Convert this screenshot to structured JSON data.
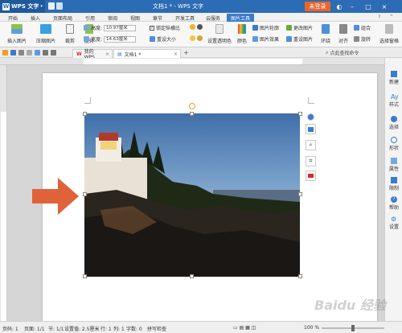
{
  "titlebar": {
    "app_name": "WPS 文字",
    "doc_title": "文档1 * - WPS 文字",
    "login_label": "未登录",
    "minimize": "–",
    "restore": "□",
    "close": "×"
  },
  "menu": {
    "tabs": [
      "开始",
      "插入",
      "页面布局",
      "引用",
      "审阅",
      "视图",
      "章节",
      "开发工具",
      "云服务",
      "图片工具"
    ],
    "active_index": 9
  },
  "ribbon": {
    "insert_picture": "插入图片",
    "compress_picture": "压缩图片",
    "crop": "裁剪",
    "rotate": "旋转",
    "height_label": "高度:",
    "height_value": "10.97厘米",
    "width_label": "宽度:",
    "width_value": "14.63厘米",
    "lock_ratio": "锁定纵横比",
    "reset_size": "重设大小",
    "set_transparent": "设置透明色",
    "color": "颜色",
    "picture_outline": "图片轮廓",
    "picture_effect": "图片效果",
    "change_picture": "更改图片",
    "reset_picture": "重设图片",
    "wrap": "环绕",
    "align": "对齐",
    "combine": "组合",
    "rotate2": "旋转",
    "select_pane": "选择窗格",
    "accent_color": "#3a7bcc"
  },
  "doc_tabs": [
    {
      "label": "我的WPS",
      "active": false
    },
    {
      "label": "文档1 *",
      "active": true
    }
  ],
  "search": {
    "placeholder": "点此查找命令"
  },
  "side_panel": [
    {
      "label": "新建",
      "icon": "new-icon"
    },
    {
      "label": "样式",
      "icon": "style-icon"
    },
    {
      "label": "选择",
      "icon": "select-icon"
    },
    {
      "label": "形状",
      "icon": "shape-icon"
    },
    {
      "label": "属性",
      "icon": "properties-icon"
    },
    {
      "label": "限制",
      "icon": "restrict-icon"
    },
    {
      "label": "帮助",
      "icon": "help-icon"
    },
    {
      "label": "设置",
      "icon": "settings-icon"
    }
  ],
  "statusbar": {
    "page_num": "页码: 1",
    "pages": "页面: 1/1",
    "section": "节: 1/1",
    "setting": "设置值: 2.5厘米",
    "row": "行: 1",
    "col": "列: 1",
    "words": "字数: 0",
    "spell": "拼写检查",
    "zoom": "100 %",
    "zoom_level": 0.5
  },
  "watermark": "Baidu 经验",
  "arrow_color": "#e0623a"
}
